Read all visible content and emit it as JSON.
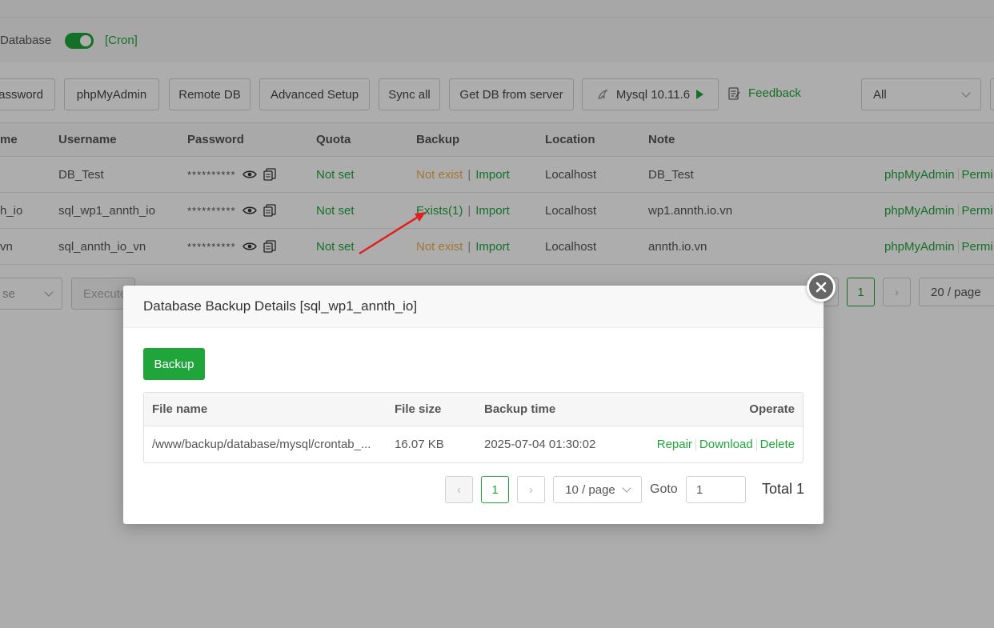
{
  "db_row": {
    "label": "Database",
    "cron": "[Cron]"
  },
  "toolbar": {
    "password": "assword",
    "phpmyadmin": "phpMyAdmin",
    "remote_db": "Remote DB",
    "advanced_setup": "Advanced Setup",
    "sync_all": "Sync all",
    "get_db": "Get DB from server",
    "mysql": "Mysql 10.11.6",
    "feedback": "Feedback",
    "filter": "All"
  },
  "table": {
    "headers": {
      "name": "me",
      "username": "Username",
      "password": "Password",
      "quota": "Quota",
      "backup": "Backup",
      "location": "Location",
      "note": "Note"
    },
    "rows": [
      {
        "name": "",
        "username": "DB_Test",
        "password": "**********",
        "quota": "Not set",
        "backup_status": "Not exist",
        "import": "Import",
        "location": "Localhost",
        "note": "DB_Test",
        "phpmyadmin": "phpMyAdmin",
        "perm": "Permi"
      },
      {
        "name": "h_io",
        "username": "sql_wp1_annth_io",
        "password": "**********",
        "quota": "Not set",
        "backup_status": "Exists(1)",
        "import": "Import",
        "location": "Localhost",
        "note": "wp1.annth.io.vn",
        "phpmyadmin": "phpMyAdmin",
        "perm": "Permi"
      },
      {
        "name": "vn",
        "username": "sql_annth_io_vn",
        "password": "**********",
        "quota": "Not set",
        "backup_status": "Not exist",
        "import": "Import",
        "location": "Localhost",
        "note": "annth.io.vn",
        "phpmyadmin": "phpMyAdmin",
        "perm": "Permi"
      }
    ]
  },
  "bottom": {
    "select": "se",
    "execute": "Execute",
    "page": "1",
    "per_page": "20 / page"
  },
  "modal": {
    "title": "Database Backup Details [sql_wp1_annth_io]",
    "backup_button": "Backup",
    "headers": {
      "file_name": "File name",
      "file_size": "File size",
      "backup_time": "Backup time",
      "operate": "Operate"
    },
    "rows": [
      {
        "file_name": "/www/backup/database/mysql/crontab_...",
        "file_size": "16.07 KB",
        "backup_time": "2025-07-04 01:30:02",
        "repair": "Repair",
        "download": "Download",
        "delete": "Delete"
      }
    ],
    "pager": {
      "page": "1",
      "per_page": "10 / page",
      "goto_label": "Goto",
      "goto_value": "1",
      "total": "Total 1"
    }
  },
  "colors": {
    "accent": "#20a53a",
    "warning": "#f0ad4e",
    "annotation_arrow": "#e02020"
  }
}
